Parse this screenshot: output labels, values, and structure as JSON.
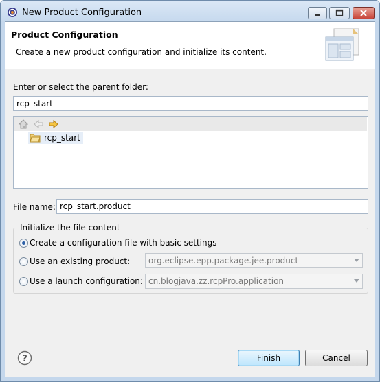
{
  "window": {
    "title": "New Product Configuration"
  },
  "header": {
    "title": "Product Configuration",
    "description": "Create a new product configuration and initialize its content."
  },
  "folder": {
    "label": "Enter or select the parent folder:",
    "value": "rcp_start",
    "tree_items": [
      "rcp_start"
    ]
  },
  "file": {
    "label": "File name:",
    "value": "rcp_start.product"
  },
  "init": {
    "group_title": "Initialize the file content",
    "option_basic": "Create a configuration file with basic settings",
    "option_existing": "Use an existing product:",
    "option_launch": "Use a launch configuration:",
    "existing_product_value": "org.eclipse.epp.package.jee.product",
    "launch_config_value": "cn.blogjava.zz.rcpPro.application",
    "selected": "basic"
  },
  "buttons": {
    "finish": "Finish",
    "cancel": "Cancel"
  },
  "icons": [
    "eclipse-app-icon",
    "minimize-icon",
    "maximize-icon",
    "close-icon",
    "wizard-banner-icon",
    "home-icon",
    "back-icon",
    "forward-icon",
    "folder-icon",
    "help-icon"
  ]
}
